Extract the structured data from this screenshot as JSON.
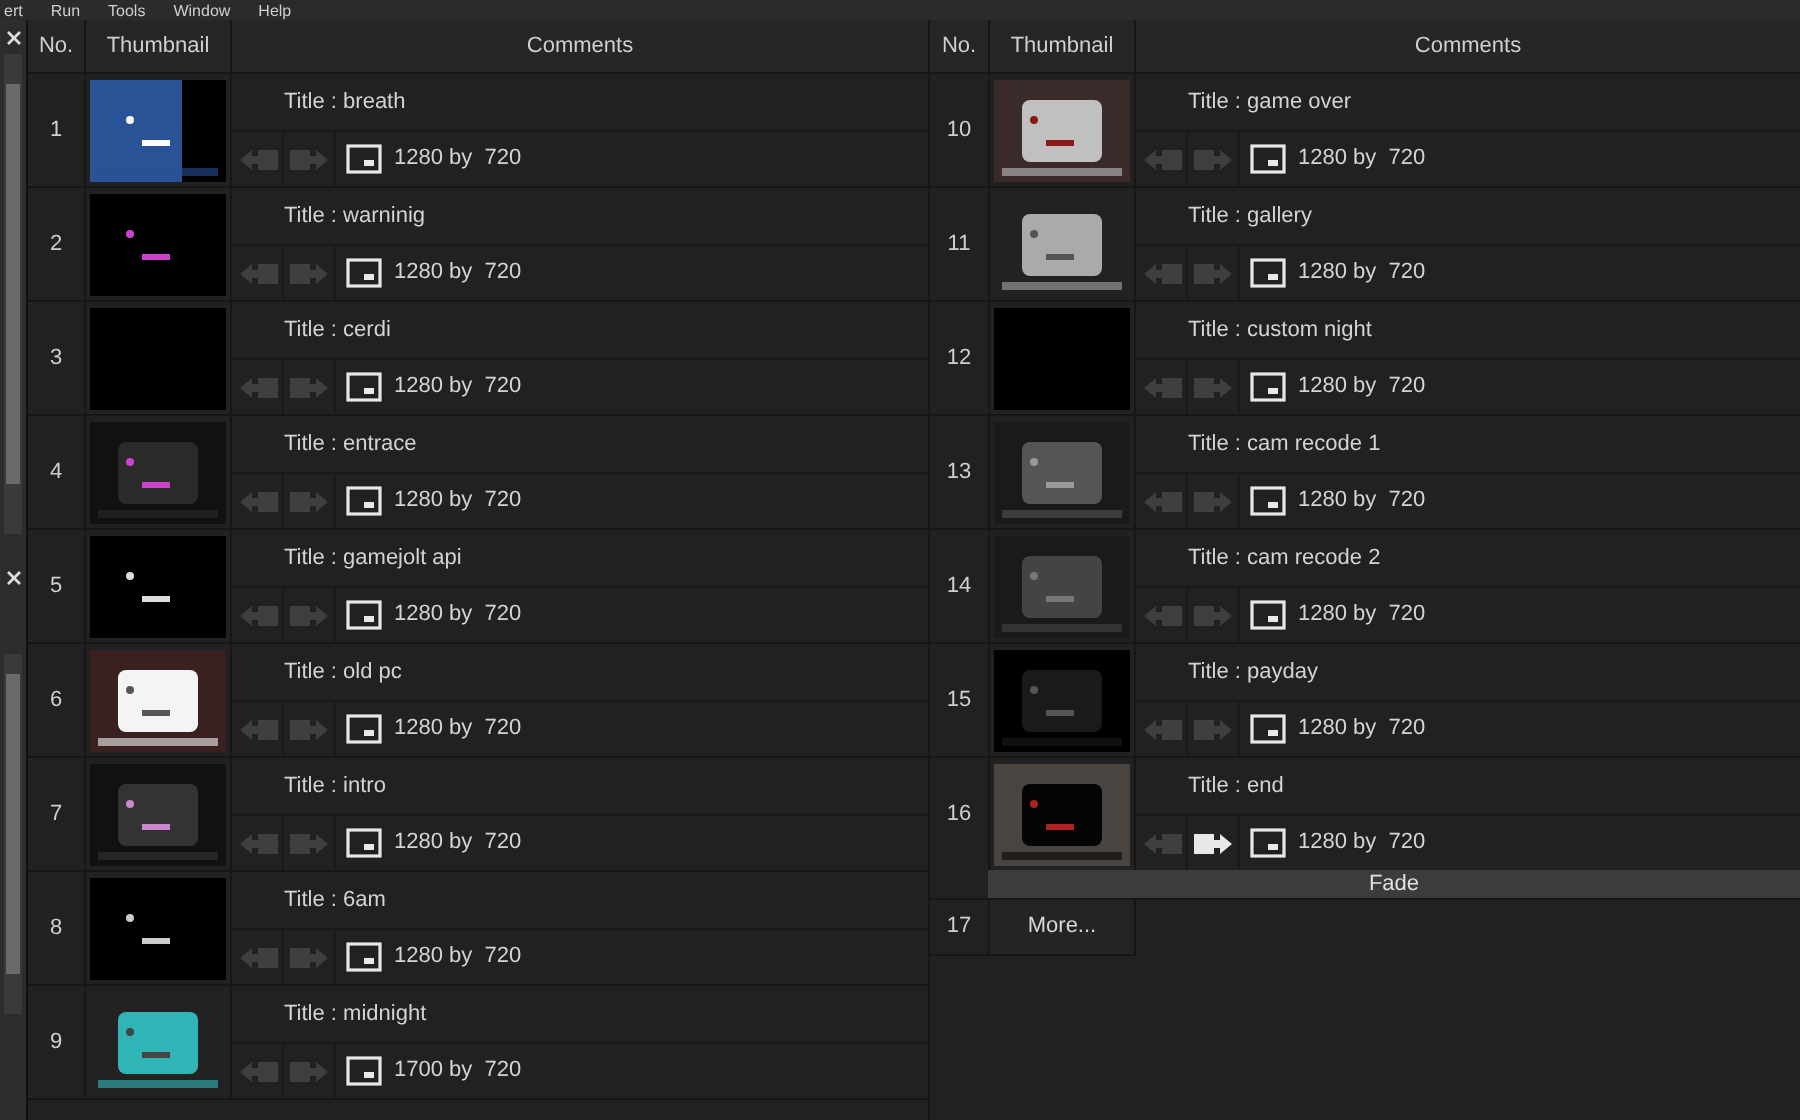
{
  "menu": [
    "ert",
    "Run",
    "Tools",
    "Window",
    "Help"
  ],
  "left_columns": [
    "No.",
    "Thumbnail",
    "Comments"
  ],
  "right_columns": [
    "No.",
    "Thumbnail",
    "Comments"
  ],
  "left_rows": [
    {
      "no": "1",
      "title": "Title : breath",
      "size": "1280 by  720",
      "next_active": false
    },
    {
      "no": "2",
      "title": "Title : warninig",
      "size": "1280 by  720",
      "next_active": false
    },
    {
      "no": "3",
      "title": "Title : cerdi",
      "size": "1280 by  720",
      "next_active": false
    },
    {
      "no": "4",
      "title": "Title : entrace",
      "size": "1280 by  720",
      "next_active": false
    },
    {
      "no": "5",
      "title": "Title : gamejolt api",
      "size": "1280 by  720",
      "next_active": false
    },
    {
      "no": "6",
      "title": "Title : old pc",
      "size": "1280 by  720",
      "next_active": false
    },
    {
      "no": "7",
      "title": "Title : intro",
      "size": "1280 by  720",
      "next_active": false
    },
    {
      "no": "8",
      "title": "Title : 6am",
      "size": "1280 by  720",
      "next_active": false
    },
    {
      "no": "9",
      "title": "Title : midnight",
      "size": "1700 by  720",
      "next_active": false
    }
  ],
  "right_rows": [
    {
      "no": "10",
      "title": "Title : game over",
      "size": "1280 by  720",
      "next_active": false
    },
    {
      "no": "11",
      "title": "Title : gallery",
      "size": "1280 by  720",
      "next_active": false
    },
    {
      "no": "12",
      "title": "Title : custom night",
      "size": "1280 by  720",
      "next_active": false
    },
    {
      "no": "13",
      "title": "Title : cam recode 1",
      "size": "1280 by  720",
      "next_active": false
    },
    {
      "no": "14",
      "title": "Title : cam recode 2",
      "size": "1280 by  720",
      "next_active": false
    },
    {
      "no": "15",
      "title": "Title : payday",
      "size": "1280 by  720",
      "next_active": false
    },
    {
      "no": "16",
      "title": "Title : end",
      "size": "1280 by  720",
      "next_active": true,
      "transition": "Fade"
    }
  ],
  "more": {
    "no": "17",
    "label": "More..."
  }
}
